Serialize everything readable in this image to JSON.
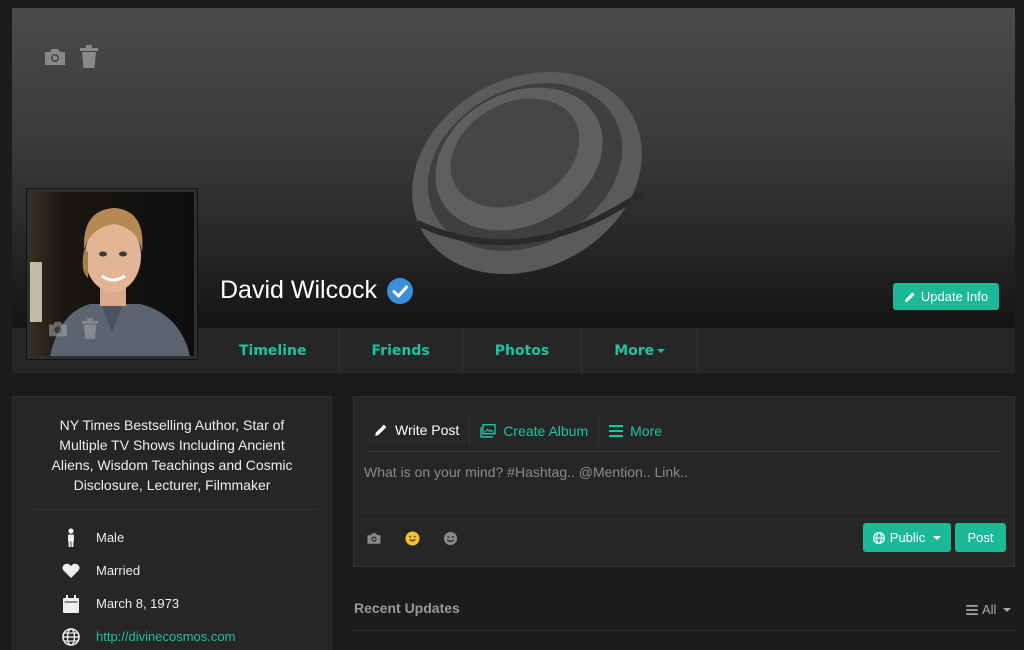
{
  "profile": {
    "name": "David Wilcock",
    "verified": true,
    "update_label": "Update Info"
  },
  "nav": {
    "tabs": [
      {
        "label": "Timeline"
      },
      {
        "label": "Friends"
      },
      {
        "label": "Photos"
      },
      {
        "label": "More"
      }
    ]
  },
  "about": {
    "bio": "NY Times Bestselling Author, Star of Multiple TV Shows Including Ancient Aliens, Wisdom Teachings and Cosmic Disclosure, Lecturer, Filmmaker",
    "gender": "Male",
    "relationship": "Married",
    "birthday": "March 8, 1973",
    "website": "http://divinecosmos.com"
  },
  "composer": {
    "tabs": [
      {
        "label": "Write Post",
        "icon": "pencil-icon"
      },
      {
        "label": "Create Album",
        "icon": "album-icon"
      },
      {
        "label": "More",
        "icon": "menu-icon"
      }
    ],
    "placeholder": "What is on your mind? #Hashtag.. @Mention.. Link..",
    "privacy_label": "Public",
    "post_label": "Post"
  },
  "feed": {
    "heading": "Recent Updates",
    "filter_label": "All"
  },
  "colors": {
    "accent": "#1cc3a3",
    "button": "#1cb998",
    "verified": "#3b8ede"
  }
}
